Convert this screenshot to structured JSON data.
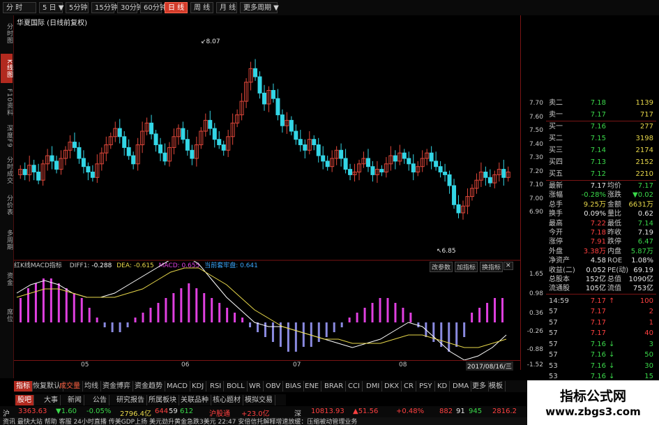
{
  "toolbar": {
    "items": [
      "分 时",
      "5 日 ▼",
      "5分钟",
      "15分钟",
      "30分钟",
      "60分钟",
      "日 线",
      "周 线",
      "月 线",
      "更多周期 ▼"
    ],
    "active_index": 6
  },
  "left_tabs": [
    "分时图",
    "K线图",
    "F10资料",
    "深度F9",
    "分时成交",
    "分价表",
    "多周期",
    "资金",
    "席位"
  ],
  "stock_title": "华夏国际 (日线前复权)",
  "price_axis": [
    "7.70",
    "7.60",
    "7.50",
    "7.40",
    "7.30",
    "7.20",
    "7.10",
    "7.00",
    "6.90"
  ],
  "high_marker": "8.07",
  "low_marker": "6.85",
  "indicator": {
    "name": "红K线MACD指标",
    "diff_label": "DIFF1:",
    "diff_value": "-0.288",
    "dea_label": "DEA:",
    "dea_value": "-0.615",
    "macd_label": "MACD:",
    "macd_value": "0.655",
    "note_label": "当前套牢盘:",
    "note_value": "0.641",
    "buttons": [
      "改参数",
      "加指标",
      "换指标",
      "✕"
    ]
  },
  "indicator_axis": [
    "1.65",
    "0.98",
    "0.36",
    "-0.26",
    "-0.88",
    "-1.52"
  ],
  "x_axis": [
    "05",
    "06",
    "07",
    "08"
  ],
  "date_label": "2017/08/16/三",
  "quote": {
    "asks": [
      {
        "label": "卖二",
        "price": "7.18",
        "vol": "1139"
      },
      {
        "label": "卖一",
        "price": "7.17",
        "vol": "717"
      }
    ],
    "bids": [
      {
        "label": "买一",
        "price": "7.16",
        "vol": "277"
      },
      {
        "label": "买二",
        "price": "7.15",
        "vol": "3198"
      },
      {
        "label": "买三",
        "price": "7.14",
        "vol": "2174"
      },
      {
        "label": "买四",
        "price": "7.13",
        "vol": "2152"
      },
      {
        "label": "买五",
        "price": "7.12",
        "vol": "2210"
      }
    ],
    "stats": [
      {
        "l1": "最新",
        "v1": "7.17",
        "c1": "white",
        "l2": "均价",
        "v2": "7.17",
        "c2": "green"
      },
      {
        "l1": "涨幅",
        "v1": "-0.28%",
        "c1": "green",
        "l2": "涨跌",
        "v2": "▼0.02",
        "c2": "green"
      },
      {
        "l1": "总手",
        "v1": "9.25万",
        "c1": "yellow",
        "l2": "金额",
        "v2": "6631万",
        "c2": "yellow"
      },
      {
        "l1": "换手",
        "v1": "0.09%",
        "c1": "white",
        "l2": "量比",
        "v2": "0.62",
        "c2": "white"
      },
      {
        "l1": "最高",
        "v1": "7.22",
        "c1": "red",
        "l2": "最低",
        "v2": "7.14",
        "c2": "green"
      },
      {
        "l1": "今开",
        "v1": "7.18",
        "c1": "red",
        "l2": "昨收",
        "v2": "7.19",
        "c2": "white"
      },
      {
        "l1": "涨停",
        "v1": "7.91",
        "c1": "red",
        "l2": "跌停",
        "v2": "6.47",
        "c2": "green"
      },
      {
        "l1": "外盘",
        "v1": "3.38万",
        "c1": "red",
        "l2": "内盘",
        "v2": "5.87万",
        "c2": "green"
      },
      {
        "l1": "净资产",
        "v1": "4.58",
        "c1": "white",
        "l2": "ROE",
        "v2": "1.08%",
        "c2": "white"
      },
      {
        "l1": "收益(二)",
        "v1": "0.052",
        "c1": "white",
        "l2": "PE(动)",
        "v2": "69.19",
        "c2": "white"
      },
      {
        "l1": "总股本",
        "v1": "152亿",
        "c1": "white",
        "l2": "总值",
        "v2": "1090亿",
        "c2": "white"
      },
      {
        "l1": "流通股",
        "v1": "105亿",
        "c1": "white",
        "l2": "流值",
        "v2": "753亿",
        "c2": "white"
      }
    ],
    "ticks": [
      {
        "t": "14:59",
        "p": "7.17",
        "arrow": "↑",
        "ac": "red",
        "v": "100"
      },
      {
        "t": "57",
        "p": "7.17",
        "arrow": "",
        "ac": "red",
        "v": "2"
      },
      {
        "t": "57",
        "p": "7.17",
        "arrow": "",
        "ac": "red",
        "v": "1"
      },
      {
        "t": "57",
        "p": "7.17",
        "arrow": "",
        "ac": "red",
        "v": "40"
      },
      {
        "t": "57",
        "p": "7.16",
        "arrow": "↓",
        "ac": "green",
        "v": "3"
      },
      {
        "t": "57",
        "p": "7.16",
        "arrow": "↓",
        "ac": "green",
        "v": "50"
      },
      {
        "t": "53",
        "p": "7.16",
        "arrow": "↓",
        "ac": "green",
        "v": "30"
      },
      {
        "t": "53",
        "p": "7.16",
        "arrow": "↓",
        "ac": "green",
        "v": "15"
      }
    ]
  },
  "bottom_tabs": [
    "指标",
    "恢复默认",
    "成交量",
    "均线",
    "资金博弈",
    "资金趋势",
    "MACD",
    "KDJ",
    "RSI",
    "BOLL",
    "WR",
    "OBV",
    "BIAS",
    "ENE",
    "BRAR",
    "CCI",
    "DMI",
    "DKX",
    "CR",
    "PSY",
    "KD",
    "DMA",
    "更多",
    "模板"
  ],
  "news_tabs": [
    "股吧",
    "大事",
    "新闻",
    "公告",
    "研究报告",
    "所属板块",
    "关联品种",
    "核心题材",
    "模拟交易"
  ],
  "index_bar": {
    "sh_label": "沪",
    "sh_value": "3363.63",
    "sh_change": "▼1.60",
    "sh_pct": "-0.05%",
    "sh_amount": "2796.4亿",
    "sh_up_down": "644",
    "sh_mid": "59",
    "sh_down": "612",
    "hgt_label": "沪股通",
    "hgt_value": "+23.0亿",
    "sz_label": "深",
    "sz_value": "10813.93",
    "sz_change": "▲51.56",
    "sz_pct": "+0.48%",
    "sz_up": "882",
    "sz_mid": "91",
    "sz_down": "945",
    "cyb_value": "2816.2"
  },
  "status_text": "资讯  最快大站  帮助  客服  24小时直播  传美GDP上扬 美元劲升黄金急跌3美元  22:47  安倍信托解释增速放缓：压缩被动管理业务",
  "watermark": {
    "title": "指标公式网",
    "url": "www.zbgs3.com"
  },
  "colors": {
    "up": "#e0473a",
    "down": "#33d6e6",
    "macd_pos": "#e040e0",
    "macd_neg": "#8a8ae0",
    "diff_line": "#ffffff",
    "dea_line": "#e8d84a",
    "axis_line": "#7a1515"
  }
}
